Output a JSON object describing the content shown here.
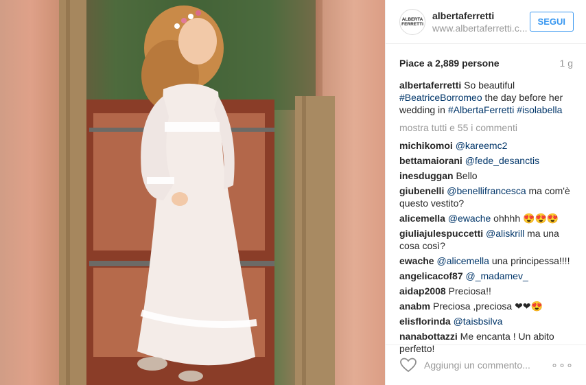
{
  "header": {
    "avatar_text": "ALBERTA FERRETTI",
    "username": "albertaferretti",
    "website": "www.albertaferretti.c...",
    "follow_label": "SEGUI"
  },
  "stats": {
    "likes": "Piace a 2,889 persone",
    "age": "1 g"
  },
  "caption": {
    "user": "albertaferretti",
    "text1": " So beautiful ",
    "tag1": "#BeatriceBorromeo",
    "text2": " the day before her wedding in ",
    "tag2": "#AlbertaFerretti",
    "text3": " ",
    "tag3": "#isolabella"
  },
  "more_comments": "mostra tutti e 55 i commenti",
  "comments": [
    {
      "user": "michikomoi",
      "mention": "@kareemc2",
      "text": ""
    },
    {
      "user": "bettamaiorani",
      "mention": "@fede_desanctis",
      "text": ""
    },
    {
      "user": "inesduggan",
      "mention": "",
      "text": " Bello"
    },
    {
      "user": "giubenelli",
      "mention": "@benellifrancesca",
      "text": " ma com'è questo vestito?"
    },
    {
      "user": "alicemella",
      "mention": "@ewache",
      "text": " ohhhh 😍😍😍"
    },
    {
      "user": "giuliajulespuccetti",
      "mention": "@aliskrill",
      "text": " ma una cosa così?"
    },
    {
      "user": "ewache",
      "mention": "@alicemella",
      "text": " una principessa!!!!"
    },
    {
      "user": "angelicacof87",
      "mention": "@_madamev_",
      "text": ""
    },
    {
      "user": "aidap2008",
      "mention": "",
      "text": " Preciosa!!"
    },
    {
      "user": "anabm",
      "mention": "",
      "text": " Preciosa ,preciosa ❤❤😍"
    },
    {
      "user": "elisflorinda",
      "mention": "@taisbsilva",
      "text": ""
    },
    {
      "user": "nanabottazzi",
      "mention": "",
      "text": " Me encanta ! Un abito perfetto!"
    }
  ],
  "footer": {
    "add_comment_placeholder": "Aggiungi un commento...",
    "more_options": "∘∘∘"
  },
  "colors": {
    "link": "#003569",
    "follow_blue": "#3897f0",
    "muted": "#999999"
  }
}
